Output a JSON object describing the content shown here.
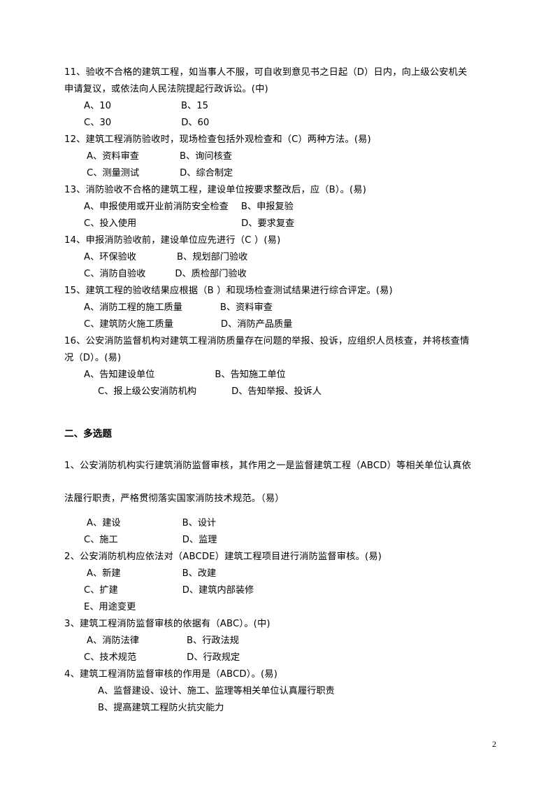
{
  "document": {
    "page_number": "2",
    "sections": [
      {
        "id": "single-choice-continued",
        "heading": null,
        "questions": [
          {
            "number": "11",
            "stem_lines": [
              "11、验收不合格的建筑工程，如当事人不服，可自收到意见书之日起（D）日内，向上级公安机关",
              "申请复议，或依法向人民法院提起行政诉讼。(中)"
            ],
            "option_rows": [
              {
                "left": "A、10",
                "right": "B、15",
                "left_indent": 28,
                "gap": 100
              },
              {
                "left": "C、30",
                "right": "D、60",
                "left_indent": 28,
                "gap": 100
              }
            ]
          },
          {
            "number": "12",
            "stem_lines": [
              "12、建筑工程消防验收时，现场检查包括外观检查和（C）两种方法。(易)"
            ],
            "option_rows": [
              {
                "left": "A、资料审查",
                "right": "B、询问核查",
                "left_indent": 32,
                "gap": 58
              },
              {
                "left": "C、测量测试",
                "right": "D、综合制定",
                "left_indent": 32,
                "gap": 58
              }
            ]
          },
          {
            "number": "13",
            "stem_lines": [
              "13、消防验收不合格的建筑工程，建设单位按要求整改后，应（B）。(易)"
            ],
            "option_rows": [
              {
                "left": "A、申报使用或开业前消防安全检查",
                "right": "B、申报复验",
                "left_indent": 28,
                "gap": 18
              },
              {
                "left": "C、投入使用",
                "right": "D、要求复查",
                "left_indent": 28,
                "gap": 150
              }
            ]
          },
          {
            "number": "14",
            "stem_lines": [
              "14、申报消防验收前，建设单位应先进行（C ）(易)"
            ],
            "option_rows": [
              {
                "left": "A、环保验收",
                "right": "B、规划部门验收",
                "left_indent": 28,
                "gap": 58
              },
              {
                "left": "C、消防自验收",
                "right": "D、质检部门验收",
                "left_indent": 28,
                "gap": 42
              }
            ]
          },
          {
            "number": "15",
            "stem_lines": [
              "15、建筑工程的验收结果应根据（B ）和现场检查测试结果进行综合评定。(易)"
            ],
            "option_rows": [
              {
                "left": "A、消防工程的施工质量",
                "right": "B、资料审查",
                "left_indent": 28,
                "gap": 54
              },
              {
                "left": "C、建筑防火施工质量",
                "right": "D、消防产品质量",
                "left_indent": 28,
                "gap": 68
              }
            ]
          },
          {
            "number": "16",
            "stem_lines": [
              "16、公安消防监督机构对建筑工程消防质量存在问题的举报、投诉，应组织人员核查，并将核查情",
              "况（D）。(易)"
            ],
            "option_rows": [
              {
                "left": "A、告知建设单位",
                "right": "B、告知施工单位",
                "left_indent": 28,
                "gap": 86
              },
              {
                "left": "C、报上级公安消防机构",
                "right": "D、告知举报、投诉人",
                "left_indent": 48,
                "gap": 50
              }
            ]
          }
        ]
      },
      {
        "id": "multiple-choice",
        "heading": "二、多选题",
        "questions": [
          {
            "number": "1",
            "stem_lines": [
              "1、公安消防机构实行建筑消防监督审核，其作用之一是监督建筑工程（ABCD）等相关单位认真依",
              "法履行职责，严格贯彻落实国家消防技术规范。（易）"
            ],
            "stem_spaced": true,
            "option_rows": [
              {
                "left": "A、建设",
                "right": "B、设计",
                "left_indent": 32,
                "gap": 88
              },
              {
                "left": "C、施工",
                "right": "D、监理",
                "left_indent": 28,
                "gap": 92
              }
            ]
          },
          {
            "number": "2",
            "stem_lines": [
              "2、公安消防机构应依法对（ABCDE）建筑工程项目进行消防监督审核。(易)"
            ],
            "option_rows": [
              {
                "left": "A、新建",
                "right": "B、改建",
                "left_indent": 32,
                "gap": 88
              },
              {
                "left": "C、扩建",
                "right": "D、建筑内部装修",
                "left_indent": 28,
                "gap": 92
              },
              {
                "left": "E、用途变更",
                "right": "",
                "left_indent": 28,
                "gap": 0
              }
            ]
          },
          {
            "number": "3",
            "stem_lines": [
              "3、建筑工程消防监督审核的依据有（ABC）。(中)"
            ],
            "option_rows": [
              {
                "left": "A、消防法律",
                "right": "B、行政法规",
                "left_indent": 32,
                "gap": 68
              },
              {
                "left": "C、技术规范",
                "right": "D、行政规定",
                "left_indent": 28,
                "gap": 72
              }
            ]
          },
          {
            "number": "4",
            "stem_lines": [
              "4、建筑工程消防监督审核的作用是（ABCD）。(易)"
            ],
            "option_rows": [
              {
                "left": "A、监督建设、设计、施工、监理等相关单位认真履行职责",
                "right": "",
                "left_indent": 48,
                "gap": 0,
                "overlapped": true
              },
              {
                "left": "B、提高建筑工程防火抗灾能力",
                "right": "",
                "left_indent": 48,
                "gap": 0
              }
            ]
          }
        ]
      }
    ]
  }
}
